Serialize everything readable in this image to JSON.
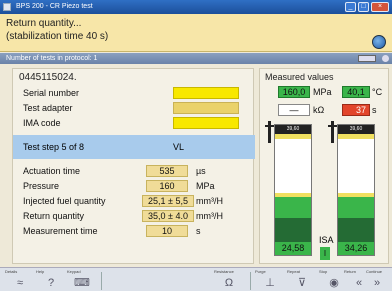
{
  "window": {
    "title": "BPS 200 - CR Piezo test",
    "minimize": "_",
    "maximize": "□",
    "close": "×"
  },
  "message": {
    "line1": "Return quantity...",
    "line2": "(stabilization time 40 s)"
  },
  "strip": {
    "text": "Number of tests in protocol: 1"
  },
  "left": {
    "part_number": "0445115024.",
    "fields": [
      {
        "label": "Serial number"
      },
      {
        "label": "Test adapter"
      },
      {
        "label": "IMA code"
      }
    ],
    "step": {
      "label": "Test step 5 of 8",
      "value": "VL"
    },
    "results": [
      {
        "label": "Actuation time",
        "value": "535",
        "unit": "µs"
      },
      {
        "label": "Pressure",
        "value": "160",
        "unit": "MPa"
      },
      {
        "label": "Injected fuel quantity",
        "value": "25,1 ± 5,5",
        "unit": "mm³/H"
      },
      {
        "label": "Return quantity",
        "value": "35,0 ± 4.0",
        "unit": "mm³/H"
      },
      {
        "label": "Measurement time",
        "value": "10",
        "unit": "s"
      }
    ]
  },
  "right": {
    "title": "Measured values",
    "pressure": {
      "value": "160,0",
      "unit": "MPa"
    },
    "temperature": {
      "value": "40,1",
      "unit": "°C"
    },
    "resistance": {
      "value": "—",
      "unit": "kΩ"
    },
    "time": {
      "value": "37",
      "unit": "s"
    },
    "bar1": {
      "value": "24,58",
      "top": "39,60"
    },
    "bar2": {
      "value": "34,26",
      "top": "39,60"
    },
    "isa": "ISA",
    "isa_sub": "I"
  },
  "toolbar": [
    {
      "label": "Details",
      "icon": "≈"
    },
    {
      "label": "Help",
      "icon": "?"
    },
    {
      "label": "Keypad",
      "icon": "⌨"
    },
    {
      "label": "",
      "icon": ""
    },
    {
      "label": "",
      "icon": ""
    },
    {
      "label": "",
      "icon": ""
    },
    {
      "label": "Resistance",
      "icon": "Ω"
    },
    {
      "label": "Purge",
      "icon": "⊥"
    },
    {
      "label": "Repeat",
      "icon": "⊽"
    },
    {
      "label": "Stop",
      "icon": "◉"
    },
    {
      "label": "Return",
      "icon": "«"
    },
    {
      "label": "Continue",
      "icon": "»"
    }
  ],
  "colors": {
    "accent": "#3ab54a",
    "warning": "#e2452b",
    "highlight": "#f8e800",
    "step": "#a8cbec"
  }
}
